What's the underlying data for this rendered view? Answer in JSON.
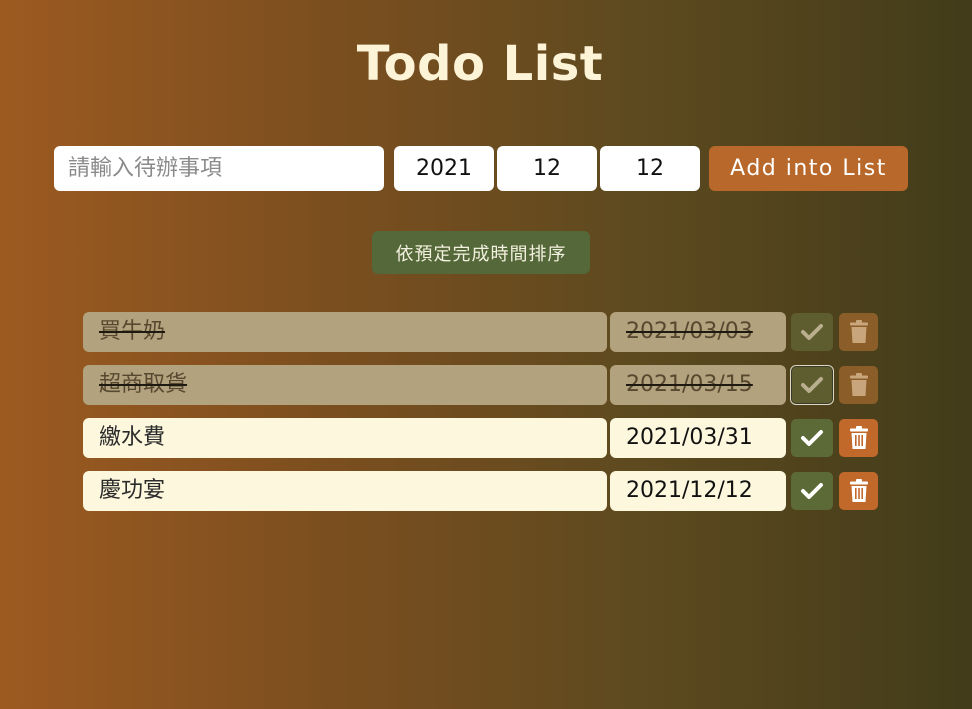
{
  "app": {
    "title": "Todo List"
  },
  "form": {
    "task_placeholder": "請輸入待辦事項",
    "task_value": "",
    "year": "2021",
    "month": "12",
    "day": "12",
    "add_label": "Add into List"
  },
  "sort": {
    "label": "依預定完成時間排序"
  },
  "todos": [
    {
      "text": "買牛奶",
      "date": "2021/03/03",
      "done": true
    },
    {
      "text": "超商取貨",
      "date": "2021/03/15",
      "done": true
    },
    {
      "text": "繳水費",
      "date": "2021/03/31",
      "done": false
    },
    {
      "text": "慶功宴",
      "date": "2021/12/12",
      "done": false
    }
  ],
  "icons": {
    "check": "check-icon",
    "trash": "trash-icon"
  },
  "colors": {
    "accent": "#b8682a",
    "sort_button": "#55683a",
    "check_button": "#5b6a36",
    "trash_button": "#c1692a",
    "item_background": "#fdf8dd",
    "done_background": "#b3a27e"
  }
}
